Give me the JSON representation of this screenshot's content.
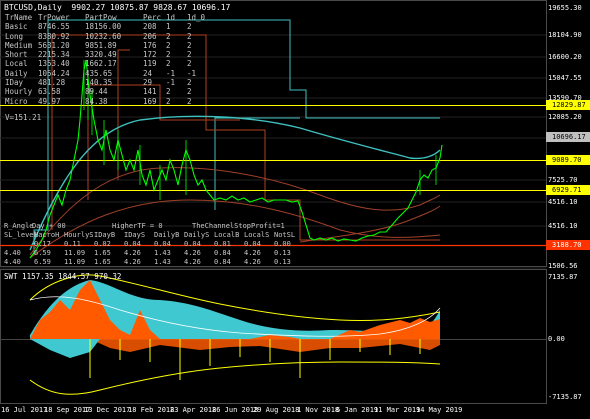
{
  "title": "BTCUSD,Daily  9902.27 10875.87 9828.67 10696.17",
  "table": {
    "header": [
      "TrName",
      "TrPower",
      "PartPow",
      "Perc",
      "1d",
      "1d_0"
    ],
    "rows": [
      [
        "Basic",
        "8746.55",
        "18156.00",
        "208",
        "1",
        "2"
      ],
      [
        "Long",
        "8380.92",
        "10232.60",
        "206",
        "2",
        "2"
      ],
      [
        "Medium",
        "5631.20",
        "9851.89",
        "176",
        "2",
        "2"
      ],
      [
        "Short",
        "2215.34",
        "3320.49",
        "172",
        "2",
        "2"
      ],
      [
        "Local",
        "1353.40",
        "1662.17",
        "119",
        "2",
        "2"
      ],
      [
        "Daily",
        "1054.24",
        "435.65",
        "24",
        "-1",
        "-1"
      ],
      [
        "IDay",
        "481.28",
        "140.35",
        "29",
        "-1",
        "2"
      ],
      [
        "Hourly",
        "63.58",
        "89.44",
        "141",
        "2",
        "2"
      ],
      [
        "Micro",
        "49.97",
        "84.38",
        "169",
        "2",
        "2"
      ]
    ]
  },
  "v_line": "V=151.21",
  "table2": {
    "header": [
      "R_Angle",
      "Day + 00",
      "HigherTF = 0",
      "TheChannelStopProfit=1"
    ],
    "sub_header": [
      "SL_level",
      "MacroH",
      "HourlyS",
      "IDayB",
      "IDayS",
      "DailyB",
      "DailyS",
      "LocalB",
      "LocalS",
      "NotSL"
    ],
    "rows": [
      [
        "",
        "0.17",
        "0.11",
        "0.02",
        "0.04",
        "0.04",
        "0.04",
        "0.01",
        "0.04",
        "0.00"
      ],
      [
        "4.40",
        "6.59",
        "11.09",
        "1.65",
        "4.26",
        "1.43",
        "4.26",
        "0.84",
        "4.26",
        "0.13"
      ],
      [
        "4.40",
        "6.59",
        "11.09",
        "1.65",
        "4.26",
        "1.43",
        "4.26",
        "0.84",
        "4.26",
        "0.13"
      ]
    ]
  },
  "price_axis": [
    "19655.30",
    "18104.90",
    "16600.20",
    "15047.55",
    "13590.70",
    "12085.20",
    "10696.17",
    "9089.70",
    "7525.70",
    "6920.90",
    "4516.10",
    "1506.56"
  ],
  "price_tags": [
    {
      "label": "12829.87",
      "color": "#ffff00"
    },
    {
      "label": "10696.17",
      "color": "#c0c0c0"
    },
    {
      "label": "9089.70",
      "color": "#ffff00"
    },
    {
      "label": "6929.71",
      "color": "#ffff00"
    },
    {
      "label": "3188.70",
      "color": "#ff3300"
    }
  ],
  "indicator": {
    "title": "SWT 1157.35 1844.57 970.32",
    "axis": [
      "7135.87",
      "0.00",
      "-7135.87"
    ]
  },
  "time_axis": [
    "16 Jul 2017",
    "18 Sep 2017",
    "13 Dec 2017",
    "18 Feb 2018",
    "23 Apr 2018",
    "26 Jun 2018",
    "29 Aug 2018",
    "1 Nov 2018",
    "6 Jan 2019",
    "11 Mar 2019",
    "14 May 2019"
  ],
  "colors": {
    "background": "#000000",
    "candles": "#00ff00",
    "teal_line": "#40c0c0",
    "yellow_line": "#ffff00",
    "red_line": "#ff3300",
    "brown_line": "#a0402a",
    "cyan_fill": "#40c8d0",
    "orange_fill": "#ff5a00"
  }
}
